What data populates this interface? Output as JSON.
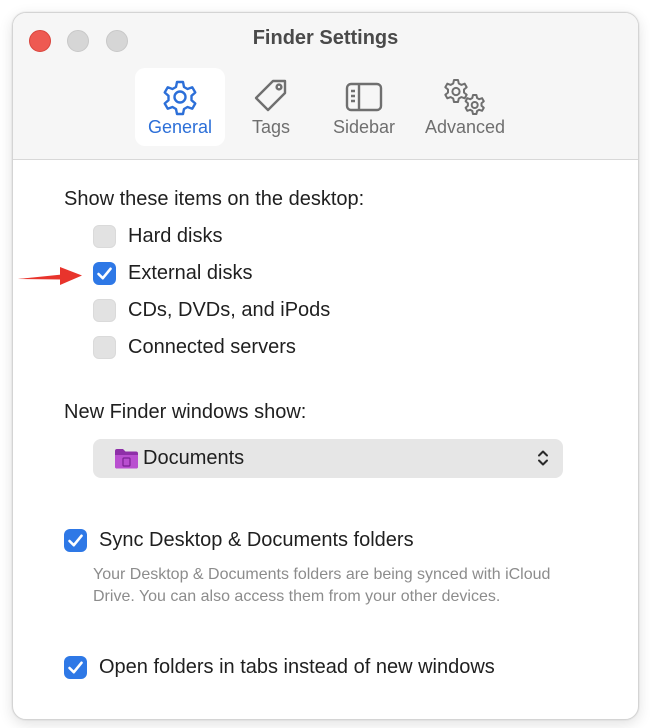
{
  "window": {
    "title": "Finder Settings"
  },
  "toolbar": {
    "tabs": [
      {
        "label": "General",
        "icon": "gear-icon",
        "selected": true
      },
      {
        "label": "Tags",
        "icon": "tag-icon",
        "selected": false
      },
      {
        "label": "Sidebar",
        "icon": "sidebar-icon",
        "selected": false
      },
      {
        "label": "Advanced",
        "icon": "gears-icon",
        "selected": false
      }
    ]
  },
  "desktop_items": {
    "heading": "Show these items on the desktop:",
    "options": [
      {
        "label": "Hard disks",
        "checked": false
      },
      {
        "label": "External disks",
        "checked": true
      },
      {
        "label": "CDs, DVDs, and iPods",
        "checked": false
      },
      {
        "label": "Connected servers",
        "checked": false
      }
    ]
  },
  "new_windows": {
    "heading": "New Finder windows show:",
    "selected": "Documents",
    "icon": "folder-icon"
  },
  "sync": {
    "label": "Sync Desktop & Documents folders",
    "checked": true,
    "description": "Your Desktop & Documents folders are being synced with iCloud Drive. You can also access them from your other devices."
  },
  "tabs_option": {
    "label": "Open folders in tabs instead of new windows",
    "checked": true
  },
  "colors": {
    "accent": "#2e78e6",
    "annotation_arrow": "#e8342c"
  }
}
